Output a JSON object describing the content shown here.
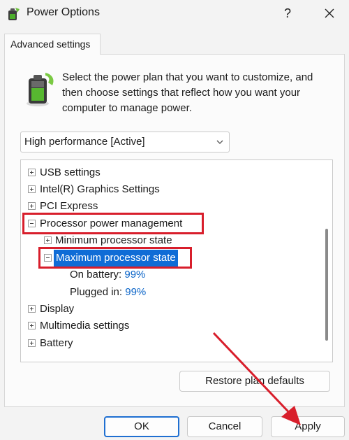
{
  "window": {
    "title": "Power Options",
    "help_label": "?",
    "icons": {
      "app": "power-options-icon",
      "close": "close-icon"
    }
  },
  "tab": {
    "label": "Advanced settings"
  },
  "intro": {
    "text": "Select the power plan that you want to customize, and then choose settings that reflect how you want your computer to manage power.",
    "icon": "battery-power-icon"
  },
  "plan_select": {
    "value": "High performance [Active]"
  },
  "tree": {
    "items": [
      {
        "label": "USB settings",
        "expander": "plus"
      },
      {
        "label": "Intel(R) Graphics Settings",
        "expander": "plus"
      },
      {
        "label": "PCI Express",
        "expander": "plus"
      },
      {
        "label": "Processor power management",
        "expander": "minus",
        "highlighted": true
      },
      {
        "label": "Minimum processor state",
        "expander": "plus"
      },
      {
        "label": "Maximum processor state",
        "expander": "minus",
        "selected": true
      },
      {
        "label": "On battery:",
        "value": "99%"
      },
      {
        "label": "Plugged in:",
        "value": "99%"
      },
      {
        "label": "Display",
        "expander": "plus"
      },
      {
        "label": "Multimedia settings",
        "expander": "plus"
      },
      {
        "label": "Battery",
        "expander": "plus"
      }
    ]
  },
  "buttons": {
    "restore": "Restore plan defaults",
    "ok": "OK",
    "cancel": "Cancel",
    "apply": "Apply"
  },
  "colors": {
    "highlight_box": "#d81e2b",
    "selection": "#0f6cd6",
    "link_value": "#0a64c8",
    "annotation_arrow": "#d81e2b"
  }
}
